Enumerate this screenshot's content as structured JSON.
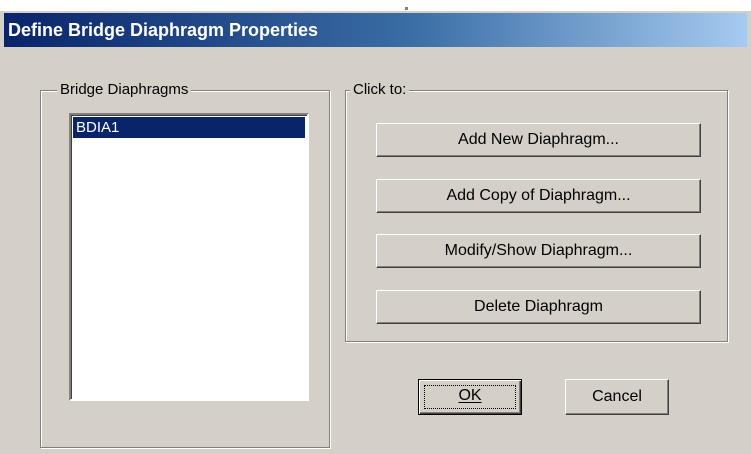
{
  "window": {
    "title": "Define Bridge Diaphragm Properties"
  },
  "diaphragms_group": {
    "label": "Bridge Diaphragms",
    "items": [
      {
        "label": "BDIA1",
        "selected": true
      }
    ]
  },
  "actions_group": {
    "label": "Click to:",
    "add_new_label": "Add New Diaphragm...",
    "add_copy_label": "Add Copy of Diaphragm...",
    "modify_label": "Modify/Show Diaphragm...",
    "delete_label": "Delete Diaphragm"
  },
  "footer": {
    "ok_label": "OK",
    "cancel_label": "Cancel"
  },
  "colors": {
    "titlebar_start": "#0a246a",
    "titlebar_end": "#a6caf0",
    "dialog_face": "#d4d0c8",
    "selection": "#0a246a"
  }
}
